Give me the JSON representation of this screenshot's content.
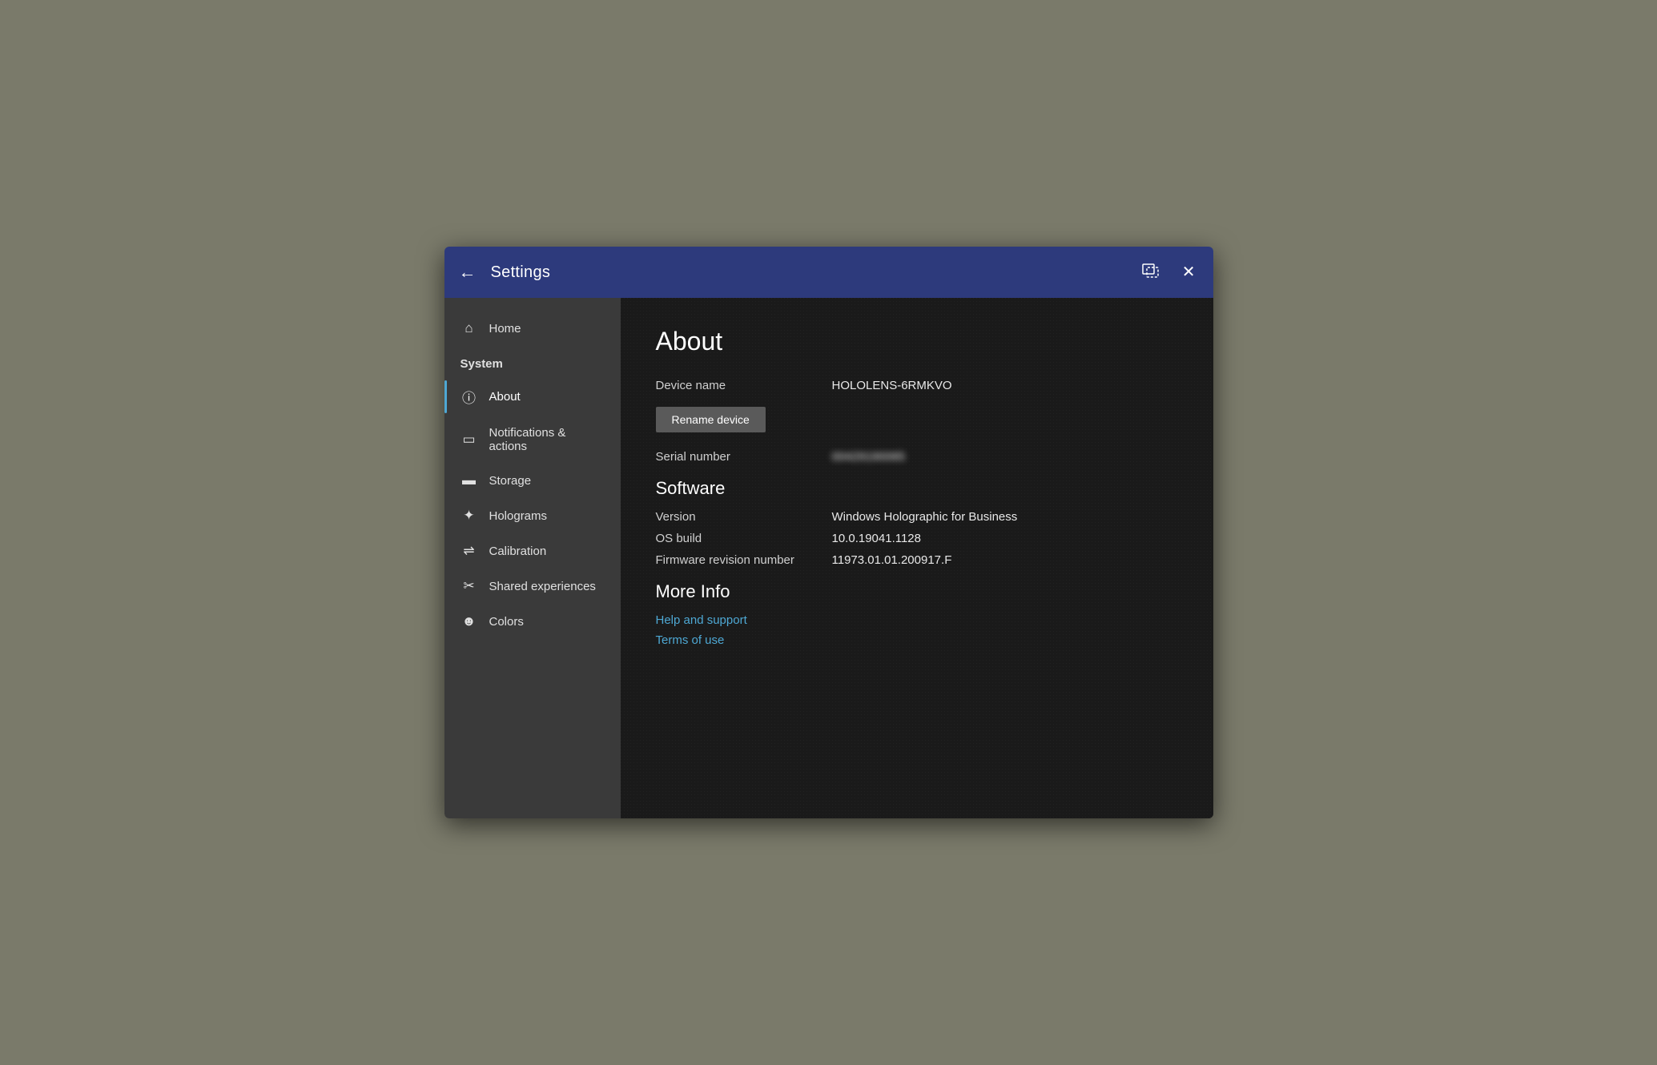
{
  "titleBar": {
    "title": "Settings",
    "backLabel": "←",
    "resizeIcon": "⬜",
    "closeIcon": "✕"
  },
  "sidebar": {
    "homeLabel": "Home",
    "systemHeader": "System",
    "items": [
      {
        "id": "about",
        "label": "About",
        "icon": "ℹ",
        "active": true
      },
      {
        "id": "notifications",
        "label": "Notifications & actions",
        "icon": "🖵",
        "active": false
      },
      {
        "id": "storage",
        "label": "Storage",
        "icon": "▬",
        "active": false
      },
      {
        "id": "holograms",
        "label": "Holograms",
        "icon": "✋",
        "active": false
      },
      {
        "id": "calibration",
        "label": "Calibration",
        "icon": "⇌",
        "active": false
      },
      {
        "id": "shared",
        "label": "Shared experiences",
        "icon": "⚙",
        "active": false
      },
      {
        "id": "colors",
        "label": "Colors",
        "icon": "☻",
        "active": false
      }
    ]
  },
  "main": {
    "pageTitle": "About",
    "deviceNameLabel": "Device name",
    "deviceNameValue": "HOLOLENS-6RMKVO",
    "renameButtonLabel": "Rename device",
    "serialNumberLabel": "Serial number",
    "serialNumberValue": "00429190065",
    "softwareSectionTitle": "Software",
    "versionLabel": "Version",
    "versionValue": "Windows Holographic for Business",
    "osBuildLabel": "OS build",
    "osBuildValue": "10.0.19041.1128",
    "firmwareLabel": "Firmware revision number",
    "firmwareValue": "11973.01.01.200917.F",
    "moreInfoTitle": "More Info",
    "helpLinkLabel": "Help and support",
    "termsLinkLabel": "Terms of use"
  }
}
